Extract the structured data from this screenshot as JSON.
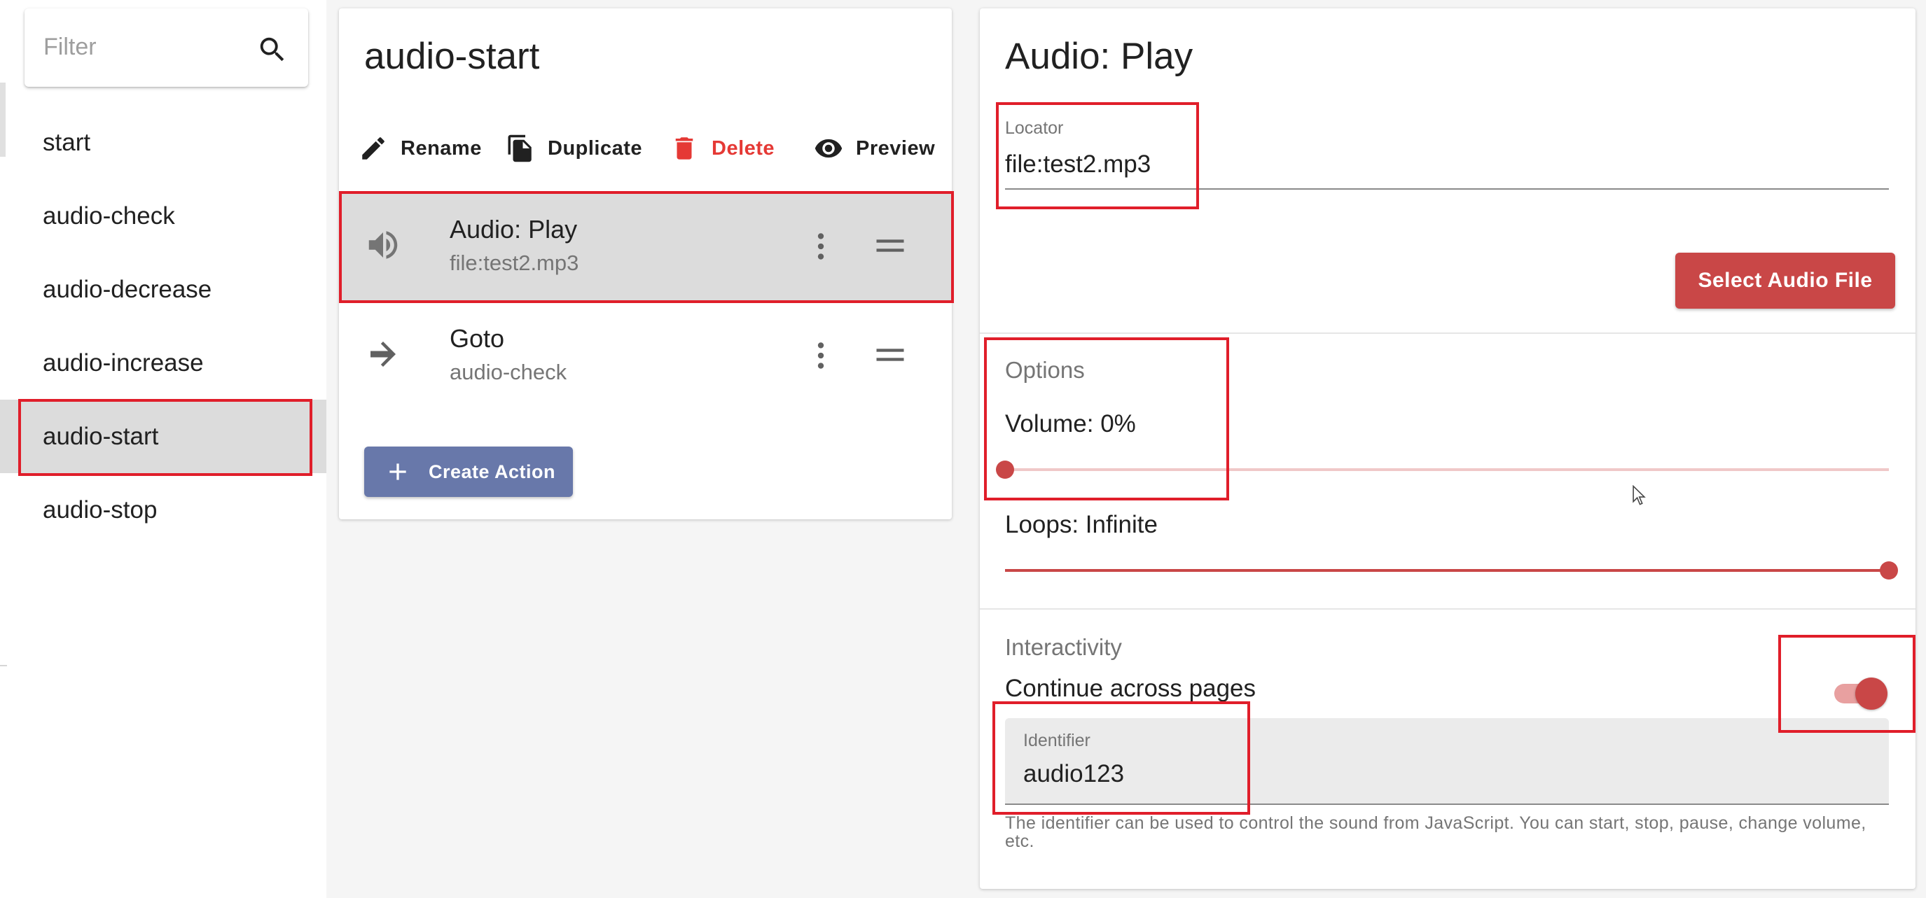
{
  "sidebar": {
    "filter_placeholder": "Filter",
    "items": [
      {
        "label": "start"
      },
      {
        "label": "audio-check"
      },
      {
        "label": "audio-decrease"
      },
      {
        "label": "audio-increase"
      },
      {
        "label": "audio-start"
      },
      {
        "label": "audio-stop"
      }
    ],
    "active_item": "audio-start"
  },
  "page": {
    "title": "audio-start",
    "toolbar": {
      "rename": "Rename",
      "duplicate": "Duplicate",
      "delete": "Delete",
      "preview": "Preview"
    },
    "actions": [
      {
        "title": "Audio: Play",
        "subtitle": "file:test2.mp3",
        "icon": "volume-icon",
        "selected": true
      },
      {
        "title": "Goto",
        "subtitle": "audio-check",
        "icon": "arrow-right-icon",
        "selected": false
      }
    ],
    "create_action": "Create Action"
  },
  "editor": {
    "title": "Audio: Play",
    "locator": {
      "label": "Locator",
      "value": "file:test2.mp3"
    },
    "select_audio_button": "Select Audio File",
    "options": {
      "section_title": "Options",
      "volume_label": "Volume: 0%",
      "volume_value": 0,
      "loops_label": "Loops: Infinite",
      "loops_fraction": 1.0
    },
    "interactivity": {
      "section_title": "Interactivity",
      "continue_label": "Continue across pages",
      "continue_enabled": true,
      "identifier": {
        "label": "Identifier",
        "value": "audio123",
        "helper": "The identifier can be used to control the sound from JavaScript. You can start, stop, pause, change volume, etc."
      }
    }
  },
  "colors": {
    "accent": "#c94747",
    "create_button": "#6878aa",
    "danger": "#e53935",
    "highlight": "#e01e2a",
    "selected_bg": "#dcdcdc"
  }
}
